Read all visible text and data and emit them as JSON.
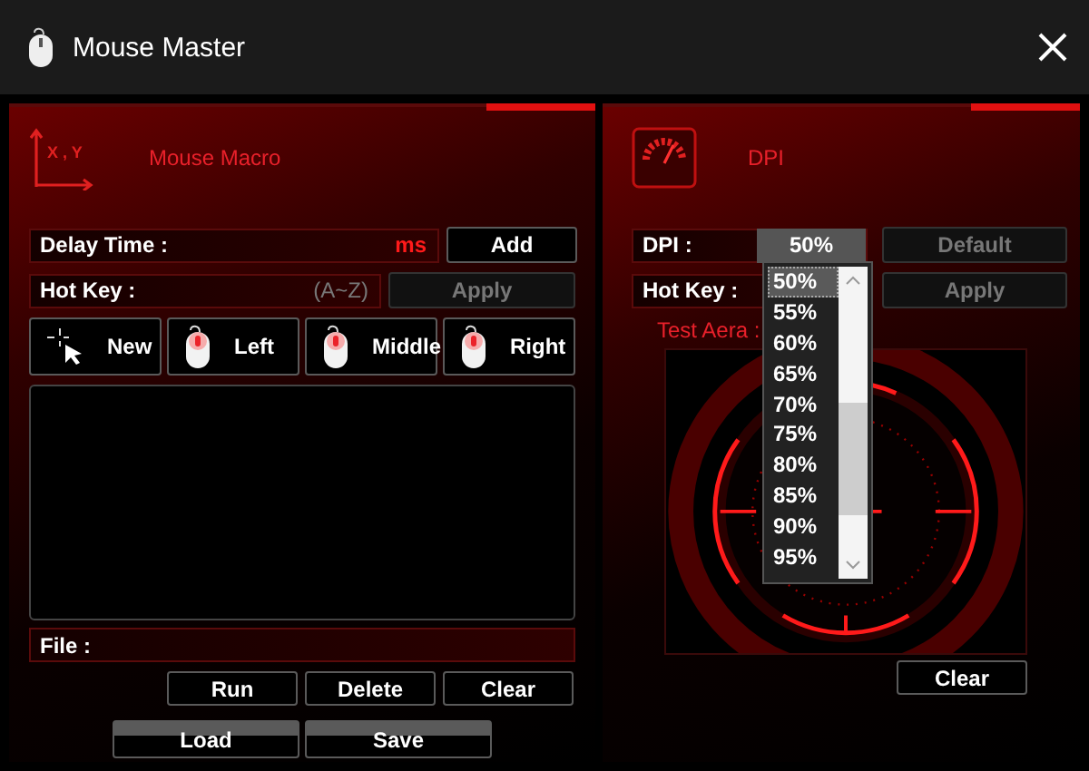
{
  "window": {
    "title": "Mouse Master"
  },
  "macro_panel": {
    "title": "Mouse Macro",
    "axis_label": "X , Y",
    "delay_field": {
      "label": "Delay Time :",
      "unit": "ms"
    },
    "add_button": {
      "label": "Add",
      "disabled": false
    },
    "hotkey_field": {
      "label": "Hot Key :",
      "hint": "(A~Z)"
    },
    "apply_button": {
      "label": "Apply",
      "disabled": true
    },
    "record_buttons": [
      {
        "label": "New",
        "kind": "cursor"
      },
      {
        "label": "Left",
        "kind": "mouse"
      },
      {
        "label": "Middle",
        "kind": "mouse"
      },
      {
        "label": "Right",
        "kind": "mouse"
      }
    ],
    "file_field": {
      "label": "File :"
    },
    "action_buttons": [
      "Run",
      "Delete",
      "Clear"
    ],
    "file_buttons": [
      "Load",
      "Save"
    ]
  },
  "dpi_panel": {
    "title": "DPI",
    "dpi_field": {
      "label": "DPI :",
      "value": "50%"
    },
    "default_button": {
      "label": "Default",
      "disabled": true
    },
    "hotkey_field": {
      "label": "Hot Key :"
    },
    "apply_button": {
      "label": "Apply",
      "disabled": true
    },
    "test_area": {
      "label": "Test Aera :"
    },
    "clear_button": "Clear",
    "dropdown": {
      "expanded": true,
      "options": [
        {
          "label": "50%",
          "selected": true
        },
        {
          "label": "55%",
          "selected": false
        },
        {
          "label": "60%",
          "selected": false
        },
        {
          "label": "65%",
          "selected": false
        },
        {
          "label": "70%",
          "selected": false
        },
        {
          "label": "75%",
          "selected": false
        },
        {
          "label": "80%",
          "selected": false
        },
        {
          "label": "85%",
          "selected": false
        },
        {
          "label": "90%",
          "selected": false
        },
        {
          "label": "95%",
          "selected": false
        }
      ]
    }
  }
}
